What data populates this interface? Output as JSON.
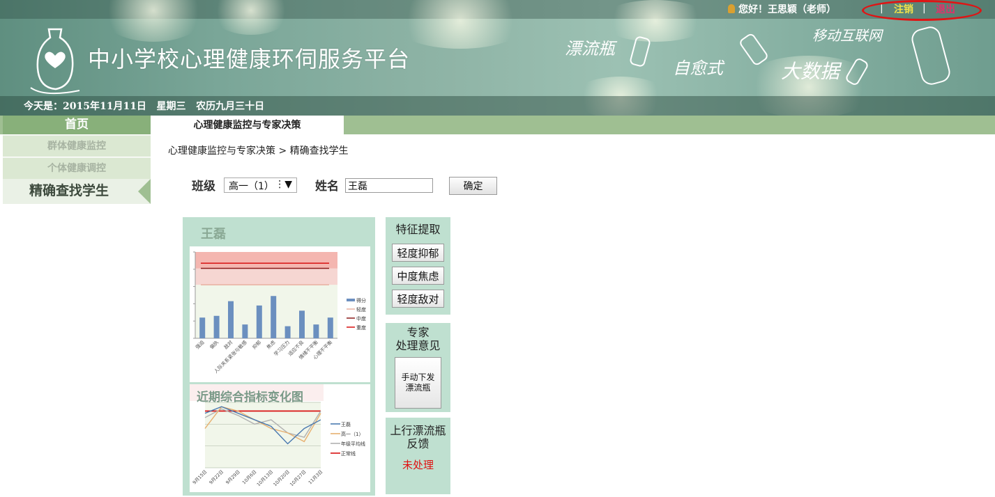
{
  "header": {
    "site_title": "中小学校心理健康环伺服务平台",
    "greeting": "您好！王思颖（老师）",
    "logout_label": "注销",
    "exit_label": "退出",
    "separator": "|",
    "date_line": "今天是：2015年11月11日   星期三   农历九月三十日",
    "slogans": [
      "漂流瓶",
      "自愈式",
      "大数据",
      "移动互联网"
    ]
  },
  "nav": {
    "home_label": "首页",
    "active_tab": "心理健康监控与专家决策"
  },
  "sidebar": {
    "items": [
      {
        "label": "群体健康监控"
      },
      {
        "label": "个体健康调控"
      },
      {
        "label": "精确查找学生"
      }
    ]
  },
  "main": {
    "breadcrumb": "心理健康监控与专家决策 > 精确查找学生",
    "search": {
      "class_label": "班级",
      "class_value": "高一（1）",
      "class_arrow": "⋮▼",
      "name_label": "姓名",
      "name_value": "王磊",
      "confirm_label": "确定"
    },
    "student": {
      "name": "王磊"
    },
    "features": {
      "title": "特征提取",
      "tags": [
        "轻度抑郁",
        "中度焦虑",
        "轻度敌对"
      ]
    },
    "expert": {
      "title_line1": "专家",
      "title_line2": "处理意见",
      "button_line1": "手动下发",
      "button_line2": "漂流瓶"
    },
    "feedback": {
      "title_line1": "上行漂流瓶",
      "title_line2": "反馈",
      "status": "未处理",
      "status_color": "#e01010"
    }
  },
  "chart_data": [
    {
      "type": "bar",
      "categories": [
        "强迫",
        "偏执",
        "敌对",
        "人际关系紧张与敏感",
        "抑郁",
        "焦虑",
        "学习压力",
        "适应不良",
        "情绪不平衡",
        "心理不平衡"
      ],
      "series": [
        {
          "name": "得分",
          "values": [
            2.4,
            2.6,
            4.3,
            1.6,
            3.8,
            4.9,
            1.4,
            3.2,
            1.6,
            2.4
          ],
          "color": "#6b8fbf"
        }
      ],
      "reference_lines": [
        {
          "name": "轻度",
          "value": 6.2,
          "color": "#e8b0a0"
        },
        {
          "name": "中度",
          "value": 8.1,
          "color": "#8b1a1a"
        },
        {
          "name": "重度",
          "value": 8.7,
          "color": "#d81010"
        }
      ],
      "ylim": [
        0,
        10
      ],
      "legend": "right",
      "grid": false
    },
    {
      "type": "line",
      "title": "近期综合指标变化图",
      "categories": [
        "9月15日",
        "9月22日",
        "9月29日",
        "10月6日",
        "10月13日",
        "10月20日",
        "10月27日",
        "11月3日"
      ],
      "series": [
        {
          "name": "王磊",
          "values": [
            2.5,
            2.8,
            2.5,
            2.2,
            1.9,
            1.1,
            1.8,
            2.2
          ],
          "color": "#4a79b0"
        },
        {
          "name": "高一（1）",
          "values": [
            1.8,
            2.8,
            2.6,
            2.2,
            1.8,
            1.6,
            1.2,
            2.5
          ],
          "color": "#e8b070"
        },
        {
          "name": "年级平均线",
          "values": [
            2.3,
            2.7,
            2.4,
            2.0,
            2.2,
            1.6,
            1.4,
            2.6
          ],
          "color": "#b0b0b0"
        },
        {
          "name": "正常线",
          "values": [
            2.6,
            2.6,
            2.6,
            2.6,
            2.6,
            2.6,
            2.6,
            2.6
          ],
          "color": "#d81010"
        }
      ],
      "ylim": [
        0,
        3
      ],
      "legend": "right",
      "grid": true
    }
  ]
}
